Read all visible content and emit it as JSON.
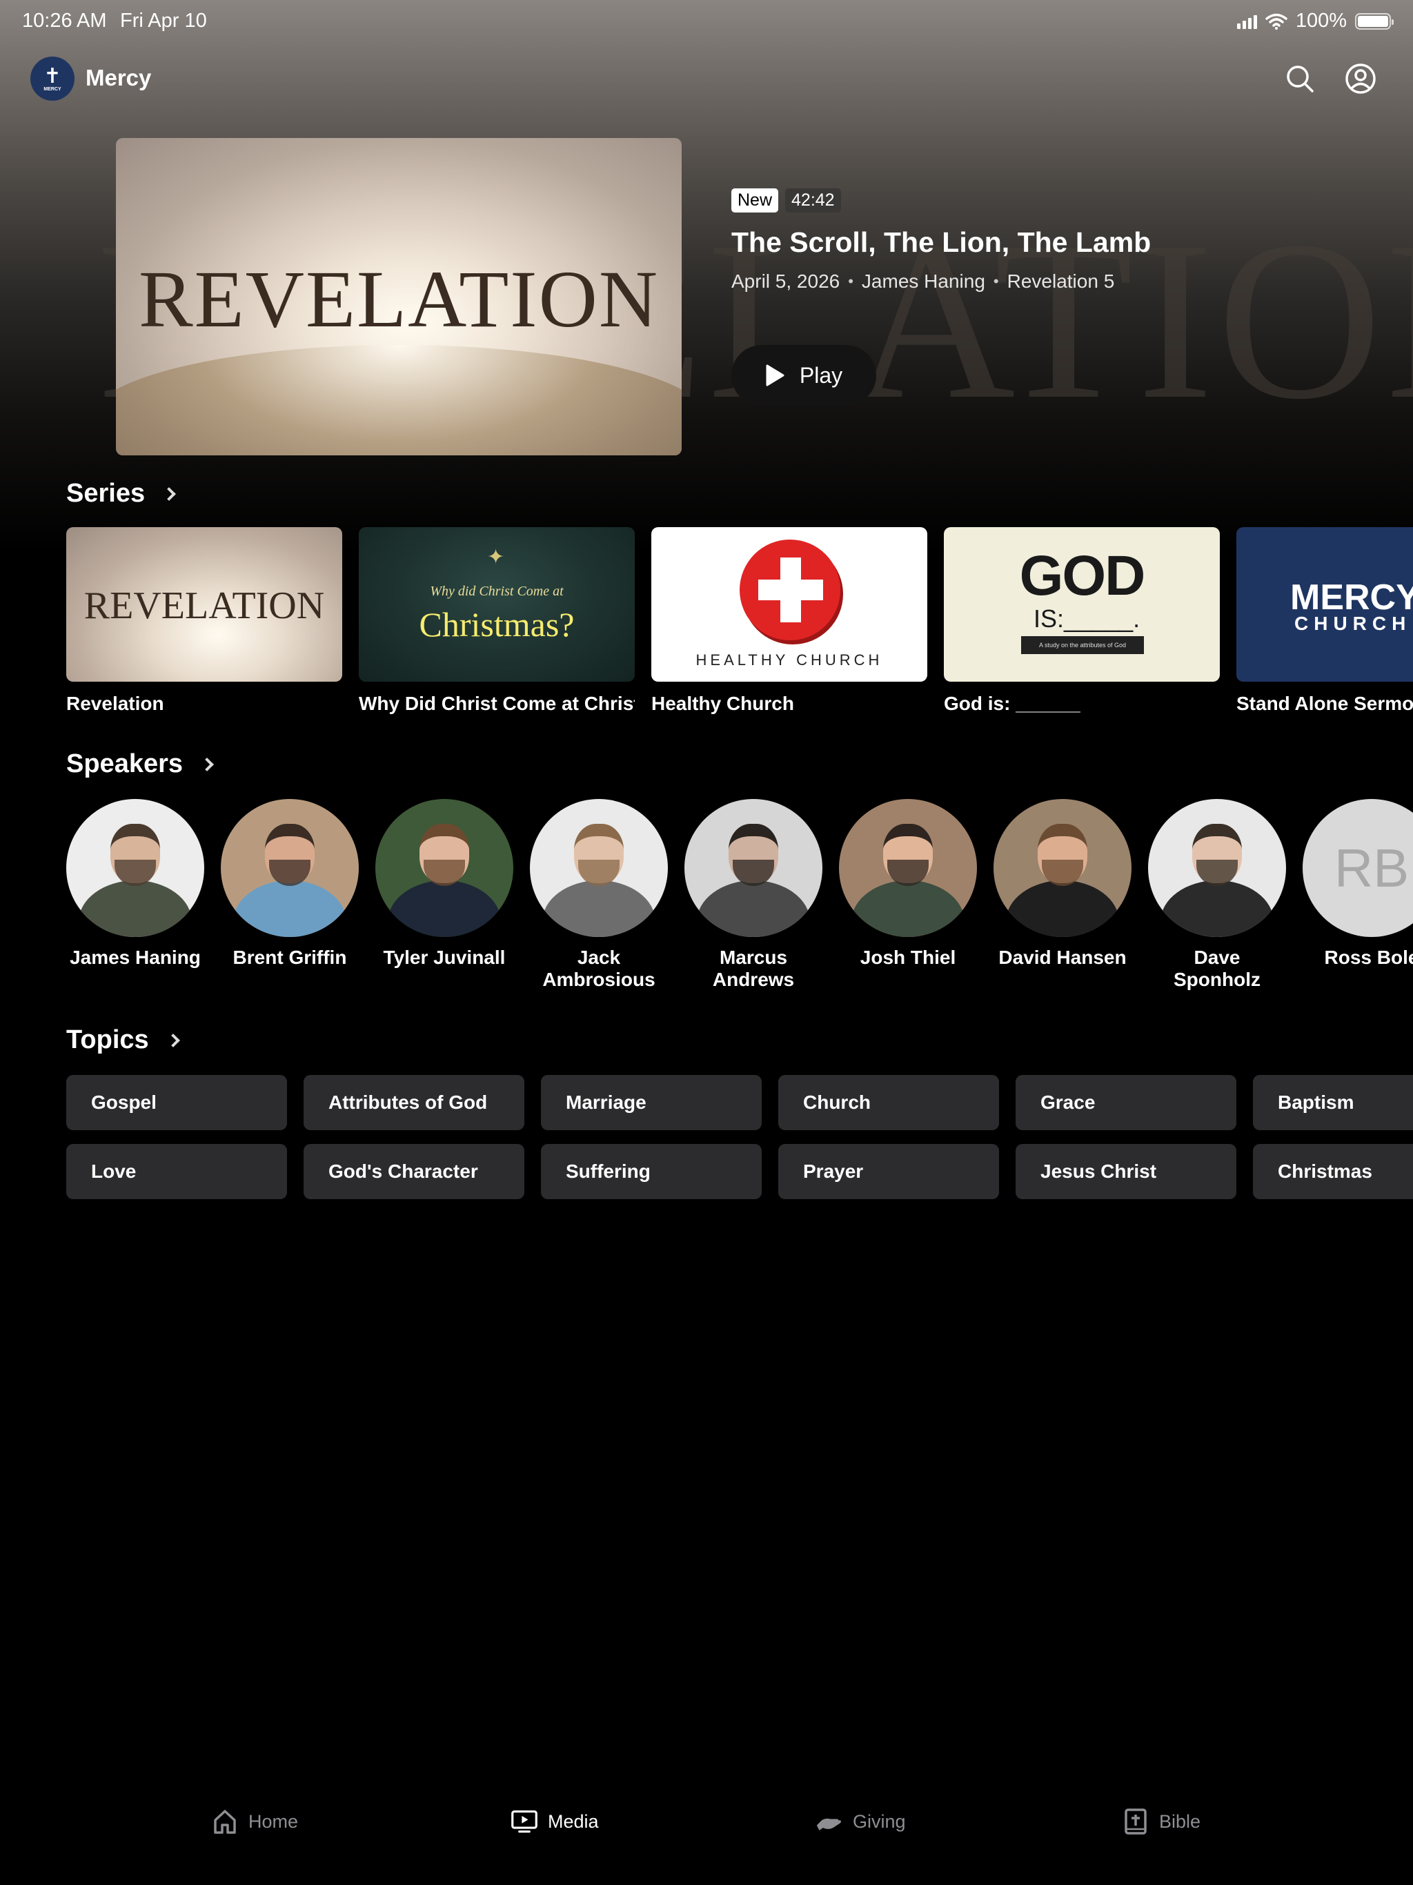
{
  "status_bar": {
    "time": "10:26 AM",
    "date": "Fri Apr 10",
    "battery": "100%",
    "battery_level": 1.0
  },
  "header": {
    "app_name": "Mercy",
    "logo_text": "MERCY",
    "search_icon": "search-icon",
    "account_icon": "person-circle-icon"
  },
  "hero": {
    "artwork_text": "REVELATION",
    "badge_new": "New",
    "duration": "42:42",
    "title": "The Scroll, The Lion, The Lamb",
    "date": "April 5, 2026",
    "speaker": "James Haning",
    "series": "Revelation 5",
    "play_label": "Play"
  },
  "series": {
    "title": "Series",
    "items": [
      {
        "name": "Revelation",
        "art": {
          "word": "REVELATION"
        }
      },
      {
        "name": "Why Did Christ Come at Christmas?",
        "art": {
          "small": "Why did Christ Come at",
          "big": "Christmas?"
        }
      },
      {
        "name": "Healthy Church",
        "art": {
          "label": "HEALTHY CHURCH"
        }
      },
      {
        "name": "God is: ______",
        "art": {
          "line1": "GOD",
          "line2": "IS:_____.",
          "line3": "A study on the attributes of God"
        }
      },
      {
        "name": "Stand Alone Sermons",
        "art": {
          "line1": "MERCY",
          "line2": "CHURCH"
        }
      }
    ]
  },
  "speakers": {
    "title": "Speakers",
    "items": [
      {
        "name": "James Haning",
        "skin": "#d8b49a",
        "hair": "#4a3a2e",
        "shirt": "#4b5344",
        "bg": "#ededed"
      },
      {
        "name": "Brent Griffin",
        "skin": "#d9a98e",
        "hair": "#3b2d24",
        "shirt": "#6c9ec4",
        "bg": "#b89b7e"
      },
      {
        "name": "Tyler Juvinall",
        "skin": "#e0b79d",
        "hair": "#6b4a30",
        "shirt": "#1e2838",
        "bg": "#3f5a38"
      },
      {
        "name": "Jack Ambrosious",
        "skin": "#e2c1aa",
        "hair": "#8a6a4a",
        "shirt": "#6d6d6d",
        "bg": "#eaeaea"
      },
      {
        "name": "Marcus Andrews",
        "skin": "#cfb19f",
        "hair": "#2a2420",
        "shirt": "#4a4a4a",
        "bg": "#d6d6d6"
      },
      {
        "name": "Josh Thiel",
        "skin": "#e1b597",
        "hair": "#2f2520",
        "shirt": "#3e4e40",
        "bg": "#a0826a"
      },
      {
        "name": "David Hansen",
        "skin": "#dcae8f",
        "hair": "#6b4b32",
        "shirt": "#1f1f1f",
        "bg": "#9b846c"
      },
      {
        "name": "Dave Sponholz",
        "skin": "#e3c2ad",
        "hair": "#3a3028",
        "shirt": "#2b2b2b",
        "bg": "#e8e8e8"
      },
      {
        "name": "Ross Bole",
        "initials": "RB"
      }
    ]
  },
  "topics": {
    "title": "Topics",
    "items": [
      "Gospel",
      "Attributes of God",
      "Marriage",
      "Church",
      "Grace",
      "Baptism",
      "Love",
      "God's Character",
      "Suffering",
      "Prayer",
      "Jesus Christ",
      "Christmas"
    ]
  },
  "tab_bar": {
    "items": [
      {
        "label": "Home",
        "icon": "house-icon",
        "active": false
      },
      {
        "label": "Media",
        "icon": "play-rectangle-icon",
        "active": true
      },
      {
        "label": "Giving",
        "icon": "hand-icon",
        "active": false
      },
      {
        "label": "Bible",
        "icon": "bible-icon",
        "active": false
      }
    ]
  }
}
